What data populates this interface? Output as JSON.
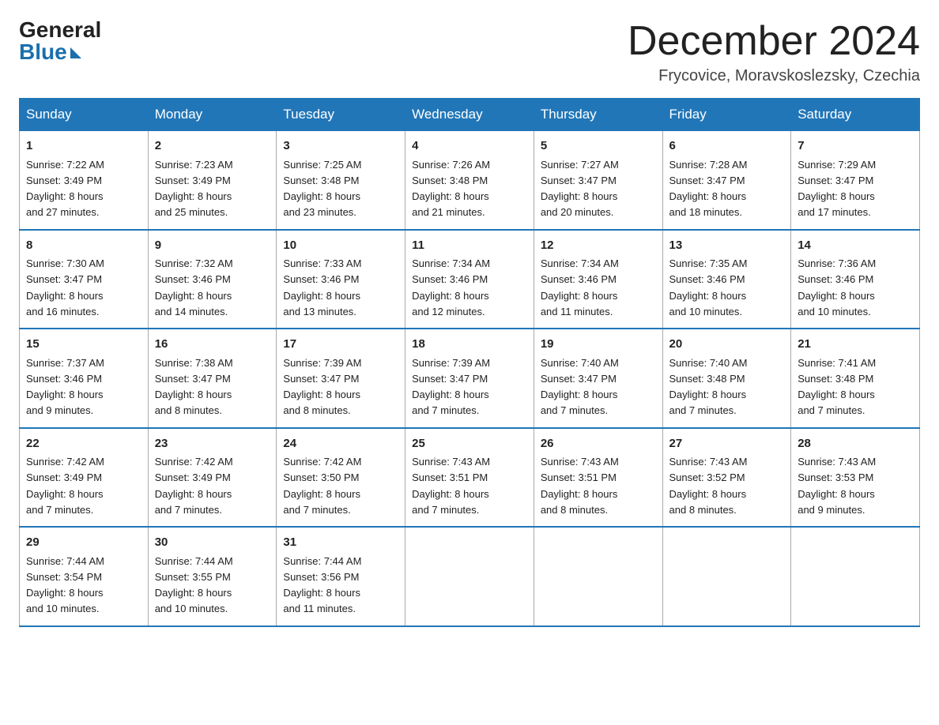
{
  "header": {
    "logo_general": "General",
    "logo_blue": "Blue",
    "month_title": "December 2024",
    "location": "Frycovice, Moravskoslezsky, Czechia"
  },
  "days_of_week": [
    "Sunday",
    "Monday",
    "Tuesday",
    "Wednesday",
    "Thursday",
    "Friday",
    "Saturday"
  ],
  "weeks": [
    [
      {
        "day": "1",
        "sunrise": "7:22 AM",
        "sunset": "3:49 PM",
        "daylight": "8 hours and 27 minutes."
      },
      {
        "day": "2",
        "sunrise": "7:23 AM",
        "sunset": "3:49 PM",
        "daylight": "8 hours and 25 minutes."
      },
      {
        "day": "3",
        "sunrise": "7:25 AM",
        "sunset": "3:48 PM",
        "daylight": "8 hours and 23 minutes."
      },
      {
        "day": "4",
        "sunrise": "7:26 AM",
        "sunset": "3:48 PM",
        "daylight": "8 hours and 21 minutes."
      },
      {
        "day": "5",
        "sunrise": "7:27 AM",
        "sunset": "3:47 PM",
        "daylight": "8 hours and 20 minutes."
      },
      {
        "day": "6",
        "sunrise": "7:28 AM",
        "sunset": "3:47 PM",
        "daylight": "8 hours and 18 minutes."
      },
      {
        "day": "7",
        "sunrise": "7:29 AM",
        "sunset": "3:47 PM",
        "daylight": "8 hours and 17 minutes."
      }
    ],
    [
      {
        "day": "8",
        "sunrise": "7:30 AM",
        "sunset": "3:47 PM",
        "daylight": "8 hours and 16 minutes."
      },
      {
        "day": "9",
        "sunrise": "7:32 AM",
        "sunset": "3:46 PM",
        "daylight": "8 hours and 14 minutes."
      },
      {
        "day": "10",
        "sunrise": "7:33 AM",
        "sunset": "3:46 PM",
        "daylight": "8 hours and 13 minutes."
      },
      {
        "day": "11",
        "sunrise": "7:34 AM",
        "sunset": "3:46 PM",
        "daylight": "8 hours and 12 minutes."
      },
      {
        "day": "12",
        "sunrise": "7:34 AM",
        "sunset": "3:46 PM",
        "daylight": "8 hours and 11 minutes."
      },
      {
        "day": "13",
        "sunrise": "7:35 AM",
        "sunset": "3:46 PM",
        "daylight": "8 hours and 10 minutes."
      },
      {
        "day": "14",
        "sunrise": "7:36 AM",
        "sunset": "3:46 PM",
        "daylight": "8 hours and 10 minutes."
      }
    ],
    [
      {
        "day": "15",
        "sunrise": "7:37 AM",
        "sunset": "3:46 PM",
        "daylight": "8 hours and 9 minutes."
      },
      {
        "day": "16",
        "sunrise": "7:38 AM",
        "sunset": "3:47 PM",
        "daylight": "8 hours and 8 minutes."
      },
      {
        "day": "17",
        "sunrise": "7:39 AM",
        "sunset": "3:47 PM",
        "daylight": "8 hours and 8 minutes."
      },
      {
        "day": "18",
        "sunrise": "7:39 AM",
        "sunset": "3:47 PM",
        "daylight": "8 hours and 7 minutes."
      },
      {
        "day": "19",
        "sunrise": "7:40 AM",
        "sunset": "3:47 PM",
        "daylight": "8 hours and 7 minutes."
      },
      {
        "day": "20",
        "sunrise": "7:40 AM",
        "sunset": "3:48 PM",
        "daylight": "8 hours and 7 minutes."
      },
      {
        "day": "21",
        "sunrise": "7:41 AM",
        "sunset": "3:48 PM",
        "daylight": "8 hours and 7 minutes."
      }
    ],
    [
      {
        "day": "22",
        "sunrise": "7:42 AM",
        "sunset": "3:49 PM",
        "daylight": "8 hours and 7 minutes."
      },
      {
        "day": "23",
        "sunrise": "7:42 AM",
        "sunset": "3:49 PM",
        "daylight": "8 hours and 7 minutes."
      },
      {
        "day": "24",
        "sunrise": "7:42 AM",
        "sunset": "3:50 PM",
        "daylight": "8 hours and 7 minutes."
      },
      {
        "day": "25",
        "sunrise": "7:43 AM",
        "sunset": "3:51 PM",
        "daylight": "8 hours and 7 minutes."
      },
      {
        "day": "26",
        "sunrise": "7:43 AM",
        "sunset": "3:51 PM",
        "daylight": "8 hours and 8 minutes."
      },
      {
        "day": "27",
        "sunrise": "7:43 AM",
        "sunset": "3:52 PM",
        "daylight": "8 hours and 8 minutes."
      },
      {
        "day": "28",
        "sunrise": "7:43 AM",
        "sunset": "3:53 PM",
        "daylight": "8 hours and 9 minutes."
      }
    ],
    [
      {
        "day": "29",
        "sunrise": "7:44 AM",
        "sunset": "3:54 PM",
        "daylight": "8 hours and 10 minutes."
      },
      {
        "day": "30",
        "sunrise": "7:44 AM",
        "sunset": "3:55 PM",
        "daylight": "8 hours and 10 minutes."
      },
      {
        "day": "31",
        "sunrise": "7:44 AM",
        "sunset": "3:56 PM",
        "daylight": "8 hours and 11 minutes."
      },
      null,
      null,
      null,
      null
    ]
  ],
  "labels": {
    "sunrise": "Sunrise:",
    "sunset": "Sunset:",
    "daylight": "Daylight:"
  }
}
